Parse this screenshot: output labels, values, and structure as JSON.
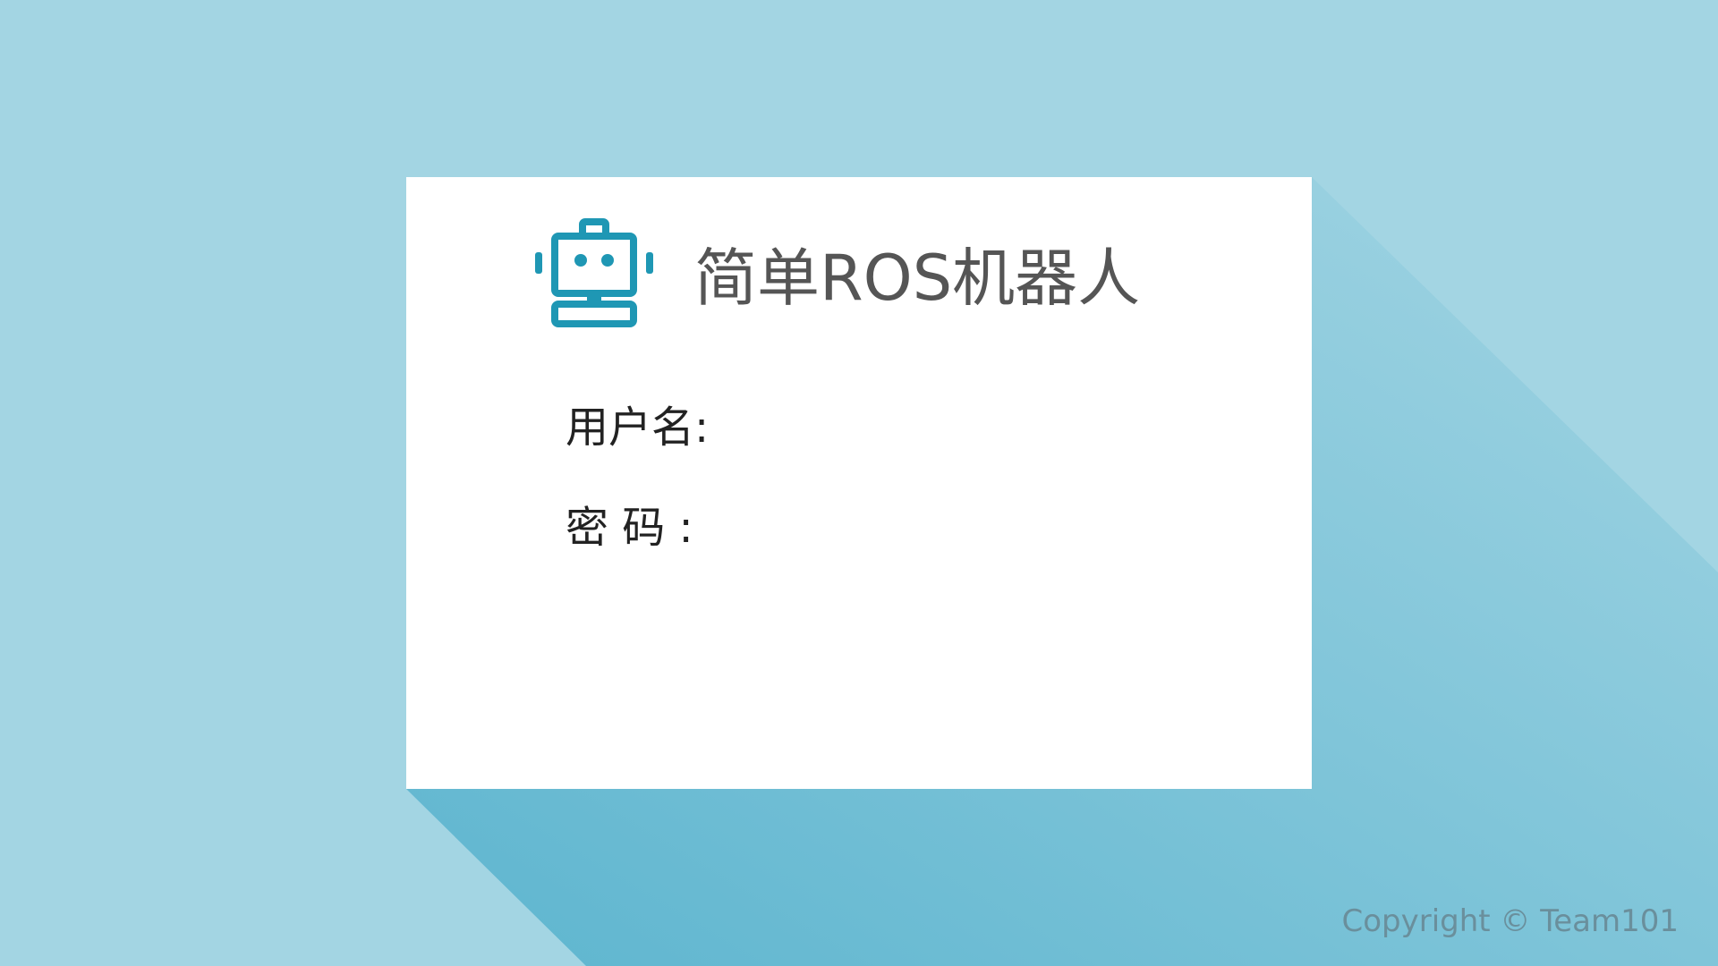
{
  "app": {
    "title": "简单ROS机器人",
    "logo_icon": "robot-icon"
  },
  "login": {
    "username_label": "用户名:",
    "username_value": "",
    "password_label": "密 码 :",
    "password_value": ""
  },
  "footer": {
    "copyright": "Copyright © Team101"
  },
  "colors": {
    "background": "#a3d5e3",
    "shadow": "#5fb6d0",
    "card": "#ffffff",
    "accent": "#1f97b4",
    "title_text": "#555555"
  }
}
